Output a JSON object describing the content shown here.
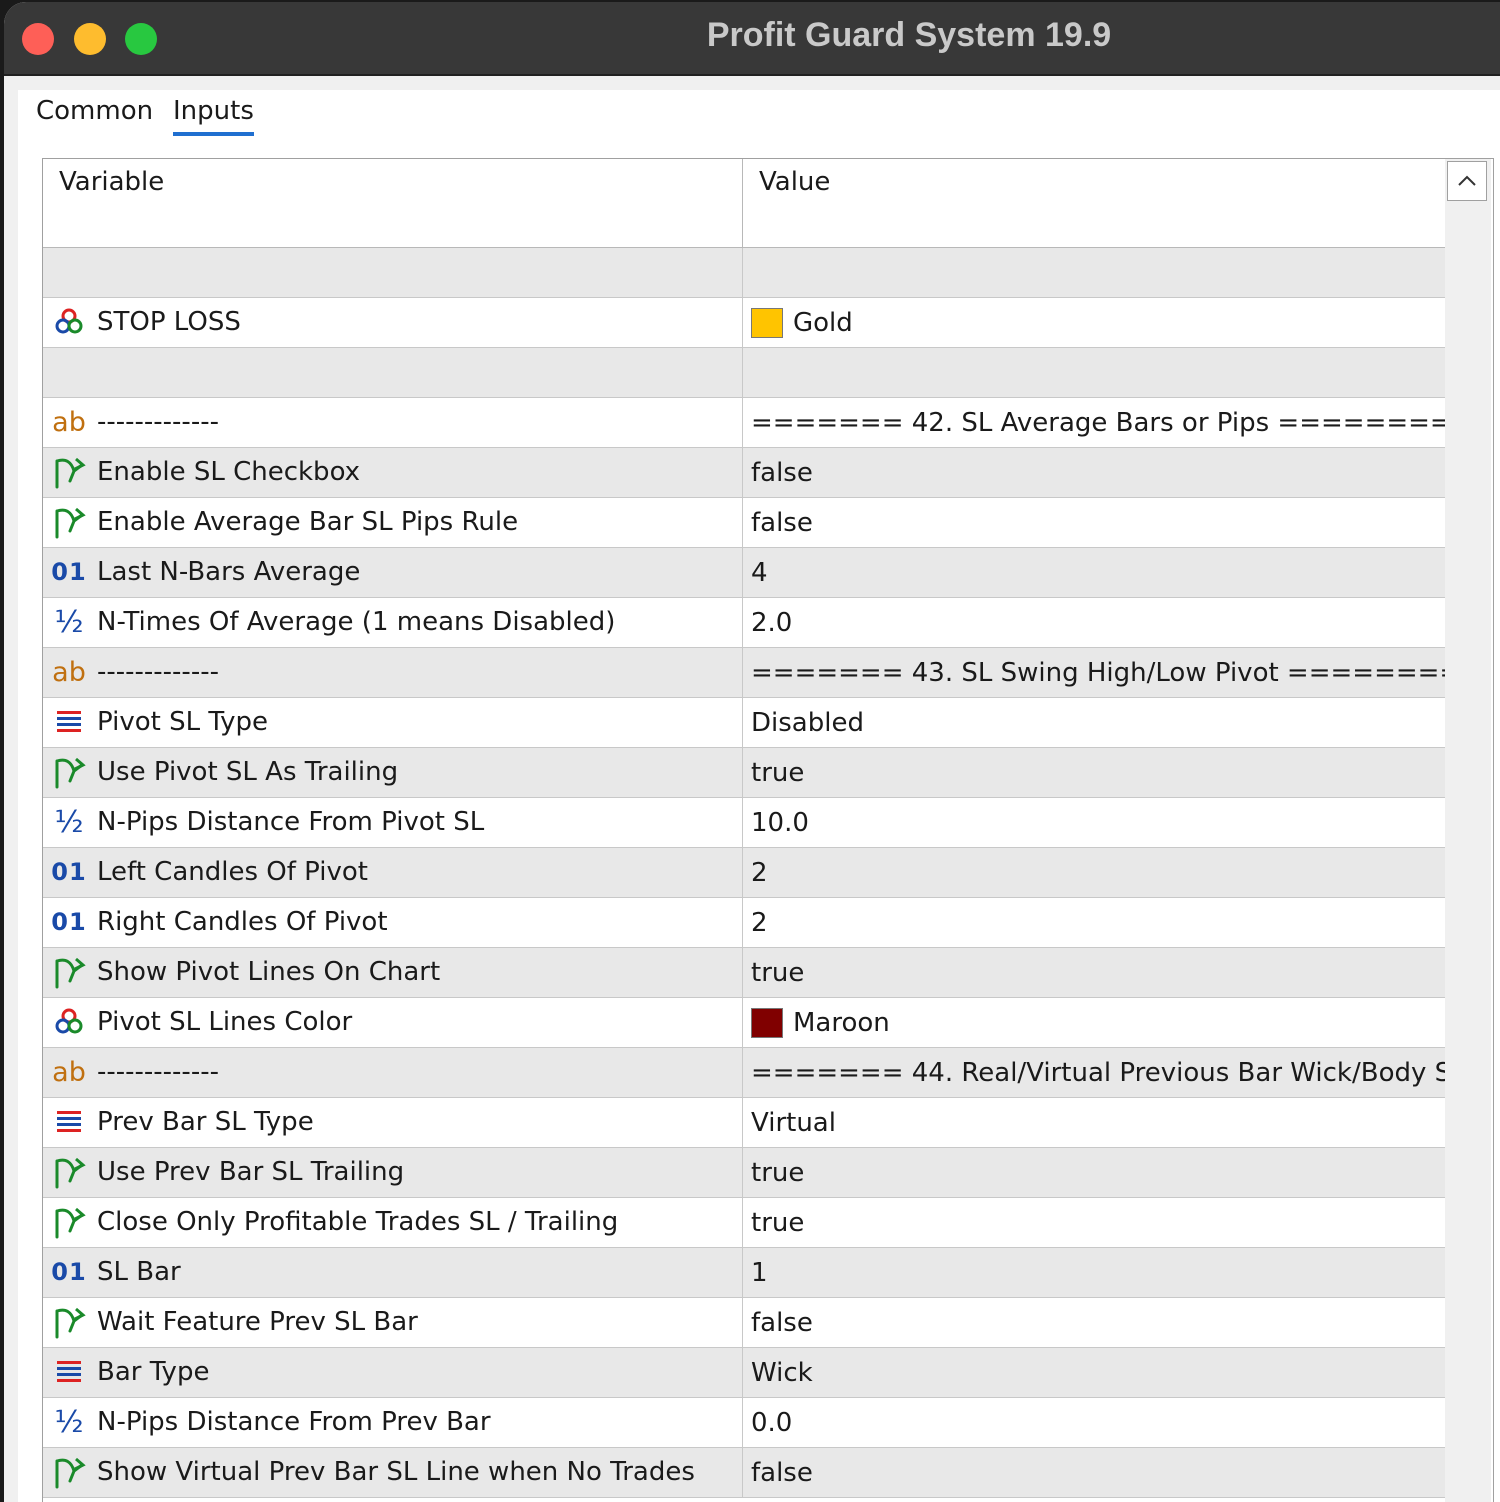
{
  "window": {
    "title": "Profit Guard System 19.9"
  },
  "tabs": [
    {
      "label": "Common",
      "active": false
    },
    {
      "label": "Inputs",
      "active": true
    }
  ],
  "table": {
    "headers": {
      "variable": "Variable",
      "value": "Value"
    },
    "rows": [
      {
        "type": "empty",
        "name": "",
        "value": ""
      },
      {
        "type": "color",
        "name": "STOP LOSS",
        "value": "Gold",
        "swatch": "#ffc400"
      },
      {
        "type": "empty",
        "name": "",
        "value": ""
      },
      {
        "type": "string",
        "name": "-------------",
        "value": "======= 42. SL Average Bars or Pips =========..."
      },
      {
        "type": "bool",
        "name": "Enable SL Checkbox",
        "value": "false"
      },
      {
        "type": "bool",
        "name": "Enable Average Bar SL Pips Rule",
        "value": "false"
      },
      {
        "type": "int",
        "name": "Last N-Bars Average",
        "value": "4"
      },
      {
        "type": "double",
        "name": "N-Times Of Average (1 means Disabled)",
        "value": "2.0"
      },
      {
        "type": "string",
        "name": "-------------",
        "value": "======= 43. SL Swing High/Low Pivot ========..."
      },
      {
        "type": "enum",
        "name": "Pivot SL Type",
        "value": "Disabled"
      },
      {
        "type": "bool",
        "name": "Use Pivot SL As Trailing",
        "value": "true"
      },
      {
        "type": "double",
        "name": "N-Pips Distance From Pivot SL",
        "value": "10.0"
      },
      {
        "type": "int",
        "name": "Left Candles Of Pivot",
        "value": "2"
      },
      {
        "type": "int",
        "name": "Right Candles Of Pivot",
        "value": "2"
      },
      {
        "type": "bool",
        "name": "Show Pivot Lines On Chart",
        "value": "true"
      },
      {
        "type": "color",
        "name": "Pivot SL Lines Color",
        "value": "Maroon",
        "swatch": "#800000"
      },
      {
        "type": "string",
        "name": "-------------",
        "value": "======= 44. Real/Virtual Previous Bar Wick/Body SL..."
      },
      {
        "type": "enum",
        "name": "Prev Bar SL Type",
        "value": "Virtual"
      },
      {
        "type": "bool",
        "name": "Use Prev Bar SL Trailing",
        "value": "true"
      },
      {
        "type": "bool",
        "name": "Close Only Profitable Trades SL / Trailing",
        "value": "true"
      },
      {
        "type": "int",
        "name": "SL Bar",
        "value": "1"
      },
      {
        "type": "bool",
        "name": "Wait Feature Prev SL Bar",
        "value": "false"
      },
      {
        "type": "enum",
        "name": "Bar Type",
        "value": "Wick"
      },
      {
        "type": "double",
        "name": "N-Pips Distance From Prev Bar",
        "value": "0.0"
      },
      {
        "type": "bool",
        "name": "Show Virtual Prev Bar SL Line when No Trades",
        "value": "false"
      }
    ]
  },
  "icon_glyphs": {
    "string": "ab",
    "int": "01",
    "double": "½"
  },
  "icons": {
    "color": "color-circles-icon",
    "string": "ab-string-icon",
    "bool": "bool-arrow-icon",
    "int": "integer-01-icon",
    "double": "fraction-icon",
    "enum": "enum-list-icon"
  },
  "colors": {
    "tab_underline": "#1f6fd0",
    "bool_icon": "#1a8a2a",
    "string_icon": "#c07010",
    "number_icon": "#1a4aa8"
  }
}
